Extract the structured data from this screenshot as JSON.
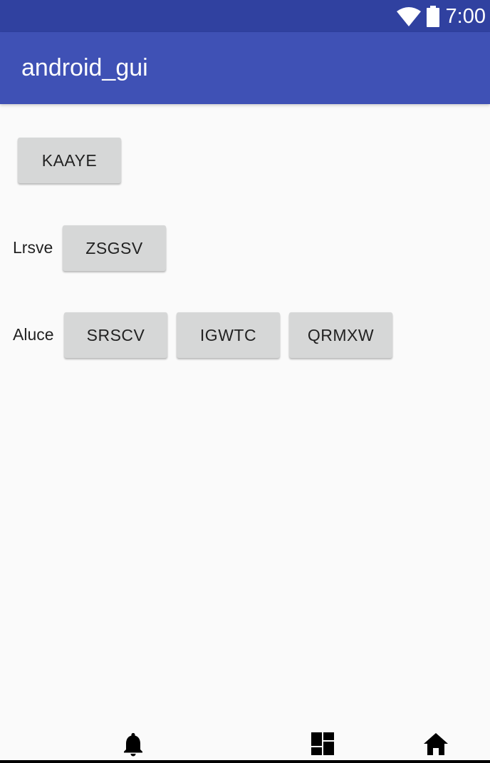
{
  "status_bar": {
    "time": "7:00",
    "icons": [
      "wifi-icon",
      "battery-icon"
    ]
  },
  "app_bar": {
    "title": "android_gui",
    "color": "#3f51b5",
    "status_color": "#3041a0"
  },
  "rows": [
    {
      "label": "",
      "buttons": [
        "KAAYE"
      ]
    },
    {
      "label": "Lrsve",
      "buttons": [
        "ZSGSV"
      ]
    },
    {
      "label": "Aluce",
      "buttons": [
        "SRSCV",
        "IGWTC",
        "QRMXW"
      ]
    }
  ],
  "nav_bar": {
    "icons": [
      "notifications-icon",
      "dashboard-icon",
      "home-icon"
    ]
  }
}
